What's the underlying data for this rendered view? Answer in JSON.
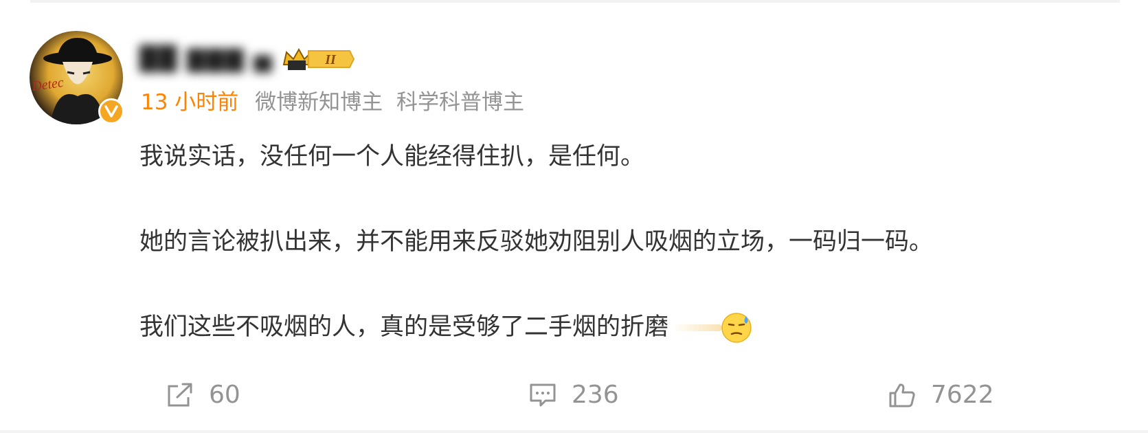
{
  "post": {
    "user": {
      "name": "██ ▇▇▇ ▅",
      "badge_level": "II",
      "verified": true
    },
    "meta": {
      "time": "13 小时前",
      "tags": [
        "微博新知博主",
        "科学科普博主"
      ]
    },
    "content": {
      "paragraphs": [
        "我说实话，没任何一个人能经得住扒，是任何。",
        "她的言论被扒出来，并不能用来反驳她劝阻别人吸烟的立场，一码归一码。",
        "我们这些不吸烟的人，真的是受够了二手烟的折磨"
      ],
      "trailing_emoji": "sweat-smile-emoji"
    },
    "actions": {
      "repost_count": "60",
      "comment_count": "236",
      "like_count": "7622"
    }
  },
  "colors": {
    "time_accent": "#ff8200",
    "secondary_text": "#939393",
    "body_text": "#333333",
    "verified_badge": "#f5a623"
  }
}
